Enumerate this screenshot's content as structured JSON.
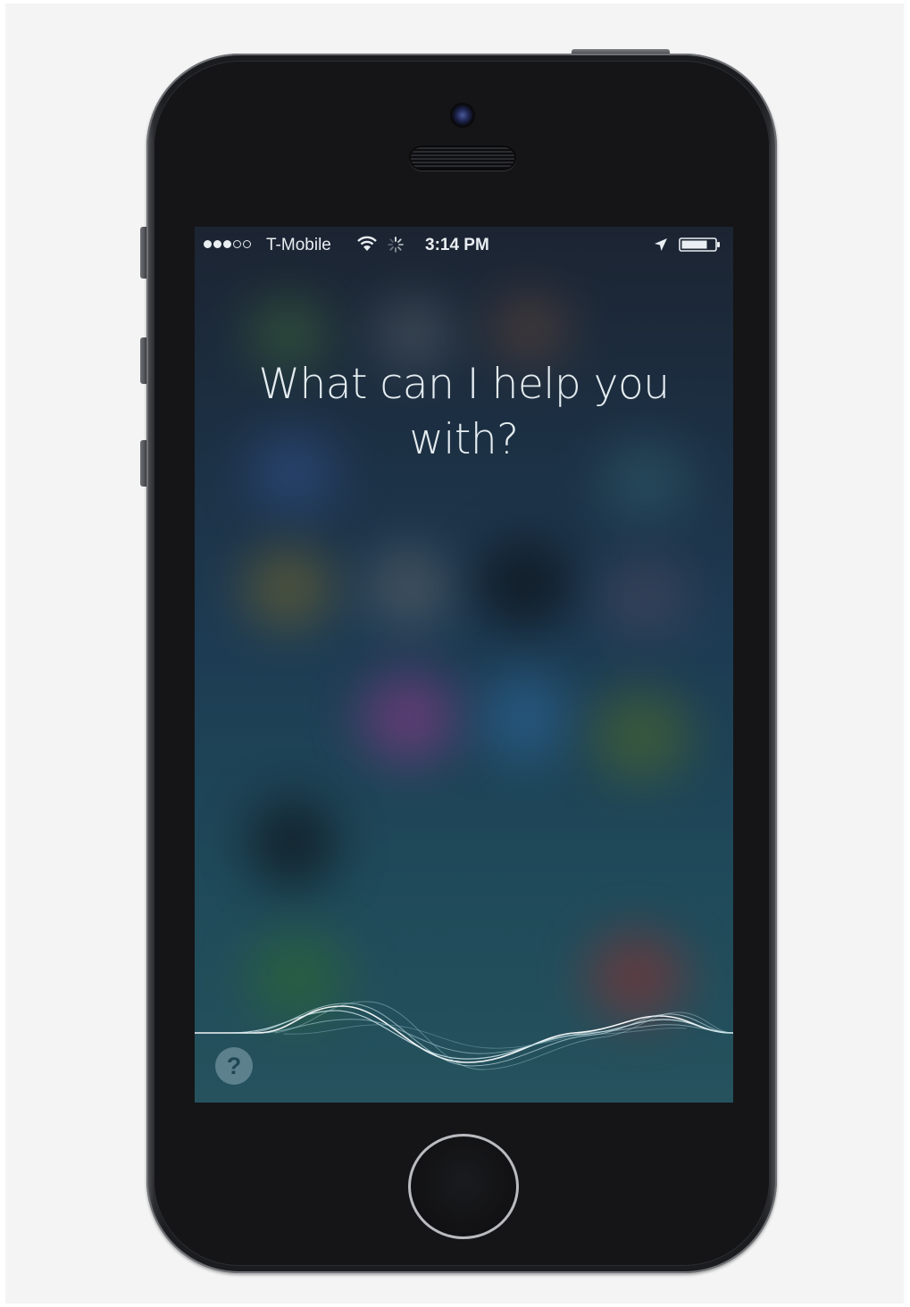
{
  "status_bar": {
    "carrier": "T-Mobile",
    "time": "3:14 PM",
    "signal_bars_filled": 3,
    "signal_bars_total": 5
  },
  "siri": {
    "prompt": "What can I help you with?",
    "help_label": "?"
  },
  "icons": {
    "signal": "signal-strength-icon",
    "wifi": "wifi-icon",
    "activity": "activity-spinner-icon",
    "location": "location-arrow-icon",
    "battery": "battery-icon",
    "help": "question-mark-icon",
    "home": "home-button"
  },
  "colors": {
    "screen_top": "#1c2432",
    "screen_bottom": "#25525d",
    "text": "#e4ecf0",
    "device_body": "#1b1c1f"
  }
}
